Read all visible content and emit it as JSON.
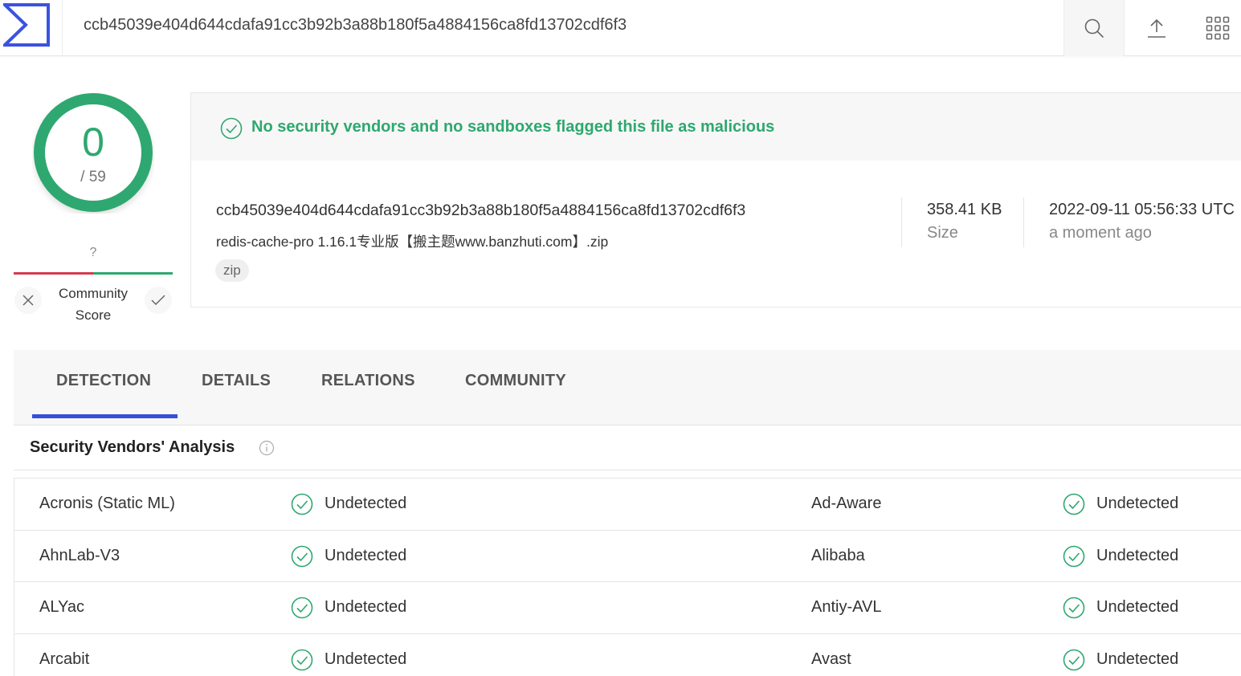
{
  "search": {
    "value": "ccb45039e404d644cdafa91cc3b92b3a88b180f5a4884156ca8fd13702cdf6f3"
  },
  "header_icons": [
    "logo-icon",
    "search-icon",
    "upload-icon",
    "apps-grid-icon"
  ],
  "score": {
    "detections": "0",
    "total": "/ 59",
    "community_unknown": "?",
    "community_label_line1": "Community",
    "community_label_line2": "Score"
  },
  "summary": {
    "banner": "No security vendors and no sandboxes flagged this file as malicious",
    "hash": "ccb45039e404d644cdafa91cc3b92b3a88b180f5a4884156ca8fd13702cdf6f3",
    "filename": "redis-cache-pro 1.16.1专业版【搬主题www.banzhuti.com】.zip",
    "tag": "zip",
    "size_value": "358.41 KB",
    "size_label": "Size",
    "date_value": "2022-09-11 05:56:33 UTC",
    "date_label": "a moment ago"
  },
  "tabs": [
    "DETECTION",
    "DETAILS",
    "RELATIONS",
    "COMMUNITY"
  ],
  "analysis": {
    "title": "Security Vendors' Analysis"
  },
  "vendors": [
    [
      "Acronis (Static ML)",
      "Undetected",
      "Ad-Aware",
      "Undetected"
    ],
    [
      "AhnLab-V3",
      "Undetected",
      "Alibaba",
      "Undetected"
    ],
    [
      "ALYac",
      "Undetected",
      "Antiy-AVL",
      "Undetected"
    ],
    [
      "Arcabit",
      "Undetected",
      "Avast",
      "Undetected"
    ]
  ],
  "colors": {
    "accent": "#3650d8",
    "clean": "#2ea86f",
    "malicious": "#d23c4f"
  }
}
